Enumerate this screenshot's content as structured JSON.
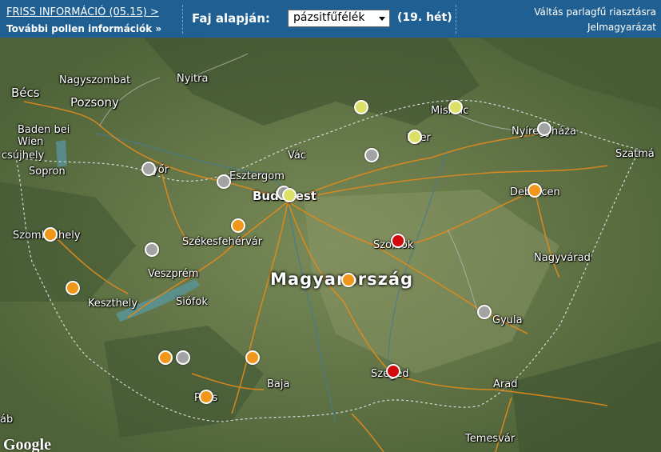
{
  "header": {
    "friss_label": "FRISS INFORMÁCIÓ (05.15) >",
    "tovabbi_label": "További pollen információk »",
    "faj_label": "Faj alapján:",
    "species_selected": "pázsitfűfélék",
    "week_label": "(19. hét)",
    "valtas_label": "Váltás parlagfű riasztásra",
    "jelmagyarazat_label": "Jelmagyarázat"
  },
  "map": {
    "country": "Magyarország",
    "attribution": "Google",
    "cities": [
      "Bécs",
      "Nagyszombat",
      "Nyitra",
      "Pozsony",
      "Baden bei Wien",
      "csújhely",
      "Sopron",
      "Győr",
      "Esztergom",
      "Vác",
      "Budapest",
      "Miskolc",
      "Eger",
      "Nyíregyháza",
      "Szatmá",
      "Debrecen",
      "Szolnok",
      "Nagyvárad",
      "Szombathely",
      "Veszprém",
      "Székesfehérvár",
      "Keszthely",
      "Siófok",
      "Gyula",
      "Szeged",
      "Baja",
      "Pécs",
      "Arad",
      "Temesvár",
      "áb"
    ],
    "stations": [
      {
        "level": "orange",
        "color": "#f0961a"
      },
      {
        "level": "orange",
        "color": "#f0961a"
      },
      {
        "level": "orange",
        "color": "#f0961a"
      },
      {
        "level": "orange",
        "color": "#f0961a"
      },
      {
        "level": "orange",
        "color": "#f0961a"
      },
      {
        "level": "orange",
        "color": "#f0961a"
      },
      {
        "level": "orange",
        "color": "#f0961a"
      },
      {
        "level": "orange",
        "color": "#f0961a"
      },
      {
        "level": "gray",
        "color": "#a3a3a3"
      },
      {
        "level": "gray",
        "color": "#a3a3a3"
      },
      {
        "level": "gray",
        "color": "#a3a3a3"
      },
      {
        "level": "gray",
        "color": "#a3a3a3"
      },
      {
        "level": "gray",
        "color": "#a3a3a3"
      },
      {
        "level": "gray",
        "color": "#a3a3a3"
      },
      {
        "level": "gray",
        "color": "#a3a3a3"
      },
      {
        "level": "gray",
        "color": "#a3a3a3"
      },
      {
        "level": "yellow",
        "color": "#dce066"
      },
      {
        "level": "yellow",
        "color": "#dce066"
      },
      {
        "level": "yellow",
        "color": "#dce066"
      },
      {
        "level": "yellow",
        "color": "#dce066"
      },
      {
        "level": "red",
        "color": "#d10b0b"
      },
      {
        "level": "red",
        "color": "#d10b0b"
      }
    ]
  }
}
